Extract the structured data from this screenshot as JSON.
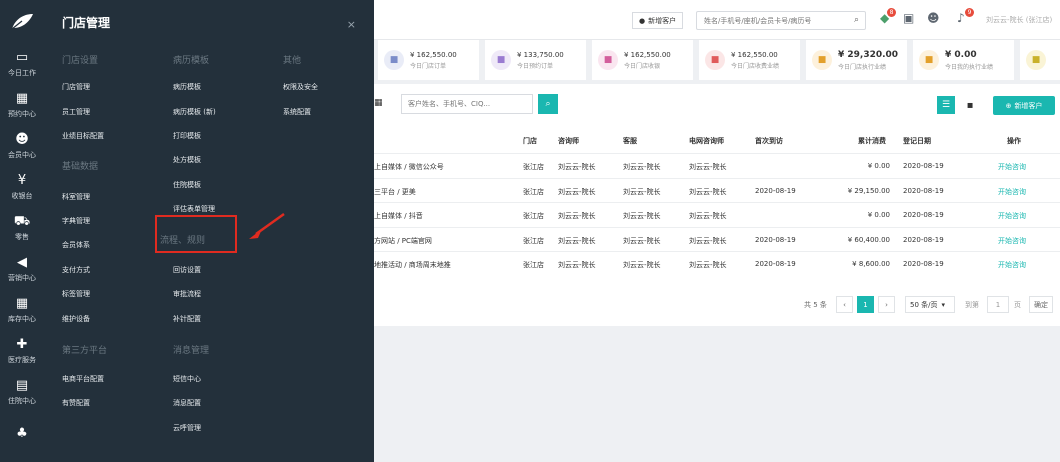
{
  "leftnav": {
    "items": [
      {
        "icon": "monitor-icon",
        "glyph": "▭",
        "label": "今日工作"
      },
      {
        "icon": "calendar-icon",
        "glyph": "▦",
        "label": "预约中心"
      },
      {
        "icon": "users-icon",
        "glyph": "☻",
        "label": "会员中心"
      },
      {
        "icon": "yuan-icon",
        "glyph": "¥",
        "label": "收银台"
      },
      {
        "icon": "cart-icon",
        "glyph": "⛟",
        "label": "零售"
      },
      {
        "icon": "megaphone-icon",
        "glyph": "◀",
        "label": "营销中心"
      },
      {
        "icon": "grid-icon",
        "glyph": "▦",
        "label": "库存中心"
      },
      {
        "icon": "medkit-icon",
        "glyph": "✚",
        "label": "医疗服务"
      },
      {
        "icon": "clipboard-icon",
        "glyph": "▤",
        "label": "住院中心"
      },
      {
        "icon": "org-chart-icon",
        "glyph": "♣",
        "label": ""
      }
    ]
  },
  "flyout": {
    "title": "门店管理",
    "close": "×",
    "sections": {
      "store_settings": "门店设置",
      "medical_templates": "病历模板",
      "other": "其他",
      "basic_data": "基础数据",
      "third_party": "第三方平台",
      "message_mgmt": "消息管理"
    },
    "col1_a": [
      "门店管理",
      "员工管理",
      "业绩目标配置"
    ],
    "col1_b": [
      "科室管理",
      "字典管理",
      "会员体系",
      "支付方式",
      "标签管理",
      "维护设备"
    ],
    "col1_c": [
      "电商平台配置",
      "有赞配置"
    ],
    "col2_a": [
      "病历模板",
      "病历模板 (新)",
      "打印模板",
      "处方模板",
      "住院模板",
      "评估表单管理"
    ],
    "col2_highlight": "流程、规则",
    "col2_b": [
      "回访设置",
      "审批流程",
      "补针配置"
    ],
    "col2_c": [
      "短信中心",
      "消息配置",
      "云呼管理"
    ],
    "col3": [
      "权限及安全",
      "系统配置"
    ]
  },
  "topbar": {
    "new_customer": "新增客户",
    "search_placeholder": "姓名/手机号/座机/会员卡号/病历号",
    "badge_bell": "8",
    "badge_notice": "9",
    "user": "刘云云-院长 (张江店)"
  },
  "stats": [
    {
      "value": "¥ 162,550.00",
      "label": "今日门店订单",
      "color": "#7b8cc9",
      "bg": "#e9ecf7",
      "icon": "bill-icon",
      "big": false
    },
    {
      "value": "¥ 133,750.00",
      "label": "今日预约订单",
      "color": "#9a7bd1",
      "bg": "#efe9f8",
      "icon": "bill-icon",
      "big": false
    },
    {
      "value": "¥ 162,550.00",
      "label": "今日门店收银",
      "color": "#d35e9c",
      "bg": "#fae6f0",
      "icon": "money-bag-icon",
      "big": false
    },
    {
      "value": "¥ 162,550.00",
      "label": "今日门店收费业绩",
      "color": "#e05b5b",
      "bg": "#fbe6e6",
      "icon": "receipt-icon",
      "big": false
    },
    {
      "value": "¥ 29,320.00",
      "label": "今日门店执行业绩",
      "color": "#e3a02b",
      "bg": "#fdf1dc",
      "icon": "clipboard-icon",
      "big": true
    },
    {
      "value": "¥ 0.00",
      "label": "今日我的执行业绩",
      "color": "#e3a02b",
      "bg": "#fdf1dc",
      "icon": "clipboard-icon",
      "big": true
    },
    {
      "value": "",
      "label": "",
      "color": "#c9b12b",
      "bg": "#faf4d6",
      "icon": "chat-icon",
      "big": false
    }
  ],
  "panel": {
    "search_placeholder": "客户姓名、手机号、CIQ...",
    "new_customer": "新增客户",
    "headers": {
      "store": "门店",
      "consultant": "咨询师",
      "service": "客服",
      "net_consultant": "电网咨询师",
      "first_visit": "首次到访",
      "total": "累计消费",
      "reg_date": "登记日期",
      "action": "操作"
    },
    "rows": [
      {
        "source": "上自媒体 / 微信公众号",
        "store": "张江店",
        "consultant": "刘云云-院长",
        "service": "刘云云-院长",
        "net": "刘云云-院长",
        "first": "",
        "total": "¥ 0.00",
        "date": "2020-08-19",
        "action": "开始咨询"
      },
      {
        "source": "三平台 / 更美",
        "store": "张江店",
        "consultant": "刘云云-院长",
        "service": "刘云云-院长",
        "net": "刘云云-院长",
        "first": "2020-08-19",
        "total": "¥ 29,150.00",
        "date": "2020-08-19",
        "action": "开始咨询"
      },
      {
        "source": "上自媒体 / 抖音",
        "store": "张江店",
        "consultant": "刘云云-院长",
        "service": "刘云云-院长",
        "net": "刘云云-院长",
        "first": "",
        "total": "¥ 0.00",
        "date": "2020-08-19",
        "action": "开始咨询"
      },
      {
        "source": "方网站 / PC端官网",
        "store": "张江店",
        "consultant": "刘云云-院长",
        "service": "刘云云-院长",
        "net": "刘云云-院长",
        "first": "2020-08-19",
        "total": "¥ 60,400.00",
        "date": "2020-08-19",
        "action": "开始咨询"
      },
      {
        "source": "地推活动 / 商场周末地推",
        "store": "张江店",
        "consultant": "刘云云-院长",
        "service": "刘云云-院长",
        "net": "刘云云-院长",
        "first": "2020-08-19",
        "total": "¥ 8,600.00",
        "date": "2020-08-19",
        "action": "开始咨询"
      }
    ]
  },
  "pager": {
    "total": "共 5 条",
    "prev": "‹",
    "current": "1",
    "next": "›",
    "page_size": "50 条/页",
    "goto": "到第",
    "goto_value": "1",
    "page_unit": "页",
    "confirm": "确定"
  }
}
